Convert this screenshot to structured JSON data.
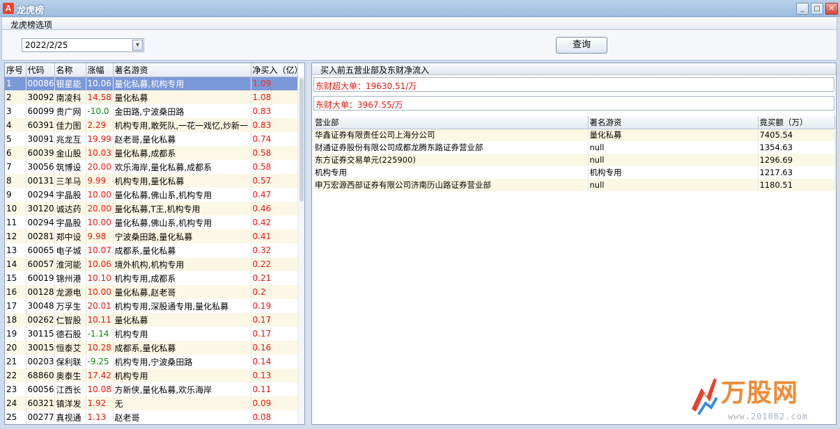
{
  "window": {
    "title": "龙虎榜",
    "icon_label": "A",
    "buttons": [
      "_",
      "□",
      "✕"
    ]
  },
  "options_bar": {
    "label": "龙虎榜选项"
  },
  "date_picker": {
    "value": "2022/2/25",
    "dropdown_glyph": "▾"
  },
  "query_button": {
    "label": "查询"
  },
  "left_table": {
    "headers": [
      "序号",
      "代码",
      "名称",
      "涨幅",
      "著名游资",
      "净买入（亿）"
    ],
    "rows": [
      [
        "1",
        "00086",
        "银星能",
        "10.06",
        "量化私募,机构专用",
        "1.09"
      ],
      [
        "2",
        "30092",
        "南凌科",
        "14.58",
        "量化私募",
        "1.08"
      ],
      [
        "3",
        "60099",
        "贵广网",
        "-10.0",
        "金田路,宁波桑田路",
        "0.83"
      ],
      [
        "4",
        "60391",
        "佳力图",
        "2.29",
        "机构专用,敢死队,一花一戏忆,炒新一",
        "0.83"
      ],
      [
        "5",
        "30091",
        "兆龙互",
        "19.99",
        "赵老哥,量化私募",
        "0.74"
      ],
      [
        "6",
        "60039",
        "金山股",
        "10.03",
        "量化私募,成都系",
        "0.58"
      ],
      [
        "7",
        "30056",
        "筑博设",
        "20.00",
        "欢乐海岸,量化私募,成都系",
        "0.58"
      ],
      [
        "8",
        "00131",
        "三羊马",
        "9.99",
        "机构专用,量化私募",
        "0.57"
      ],
      [
        "9",
        "00294",
        "宇晶股",
        "10.00",
        "量化私募,佛山系,机构专用",
        "0.47"
      ],
      [
        "10",
        "30120",
        "诚达药",
        "20.00",
        "量化私募,T王,机构专用",
        "0.46"
      ],
      [
        "11",
        "00294",
        "宇晶股",
        "10.00",
        "量化私募,佛山系,机构专用",
        "0.42"
      ],
      [
        "12",
        "00281",
        "郑中设",
        "9.98",
        "宁波桑田路,量化私募",
        "0.41"
      ],
      [
        "13",
        "60065",
        "电子城",
        "10.07",
        "成都系,量化私募",
        "0.32"
      ],
      [
        "14",
        "60057",
        "淮河能",
        "10.06",
        "境外机构,机构专用",
        "0.22"
      ],
      [
        "15",
        "60019",
        "锦州港",
        "10.10",
        "机构专用,成都系",
        "0.21"
      ],
      [
        "16",
        "00128",
        "龙源电",
        "10.00",
        "量化私募,赵老哥",
        "0.2"
      ],
      [
        "17",
        "30048",
        "万孚生",
        "20.01",
        "机构专用,深股通专用,量化私募",
        "0.19"
      ],
      [
        "18",
        "00262",
        "仁智股",
        "10.11",
        "量化私募",
        "0.17"
      ],
      [
        "19",
        "30115",
        "德石股",
        "-1.14",
        "机构专用",
        "0.17"
      ],
      [
        "20",
        "30015",
        "恒泰艾",
        "10.28",
        "成都系,量化私募",
        "0.16"
      ],
      [
        "21",
        "00203",
        "保利联",
        "-9.25",
        "机构专用,宁波桑田路",
        "0.14"
      ],
      [
        "22",
        "68860",
        "奥泰生",
        "17.42",
        "机构专用",
        "0.13"
      ],
      [
        "23",
        "60056",
        "江西长",
        "10.08",
        "方新侠,量化私募,欢乐海岸",
        "0.11"
      ],
      [
        "24",
        "60321",
        "镇洋发",
        "1.92",
        "无",
        "0.09"
      ],
      [
        "25",
        "00277",
        "真视通",
        "1.13",
        "赵老哥",
        "0.08"
      ]
    ]
  },
  "right_panel": {
    "title": "买入前五营业部及东财净流入",
    "super_large": "东财超大单：19630.51/万",
    "large": "东财大单：3967.55/万",
    "headers": [
      "营业部",
      "著名游资",
      "竟买额（万）"
    ],
    "rows": [
      [
        "华鑫证券有限责任公司上海分公司",
        "量化私募",
        "7405.54"
      ],
      [
        "财通证券股份有限公司成都龙腾东路证券营业部",
        "null",
        "1354.63"
      ],
      [
        "东方证券交易单元(225900)",
        "null",
        "1296.69"
      ],
      [
        "机构专用",
        "机构专用",
        "1217.63"
      ],
      [
        "申万宏源西部证券有限公司济南历山路证券营业部",
        "null",
        "1180.51"
      ]
    ]
  },
  "watermark": {
    "brand": "万股网",
    "url": "www.201082.com"
  },
  "colors": {
    "up": "#e8170f",
    "down": "#0a8a0a",
    "selected": "#7b98d8",
    "brand": "#f08a34"
  }
}
